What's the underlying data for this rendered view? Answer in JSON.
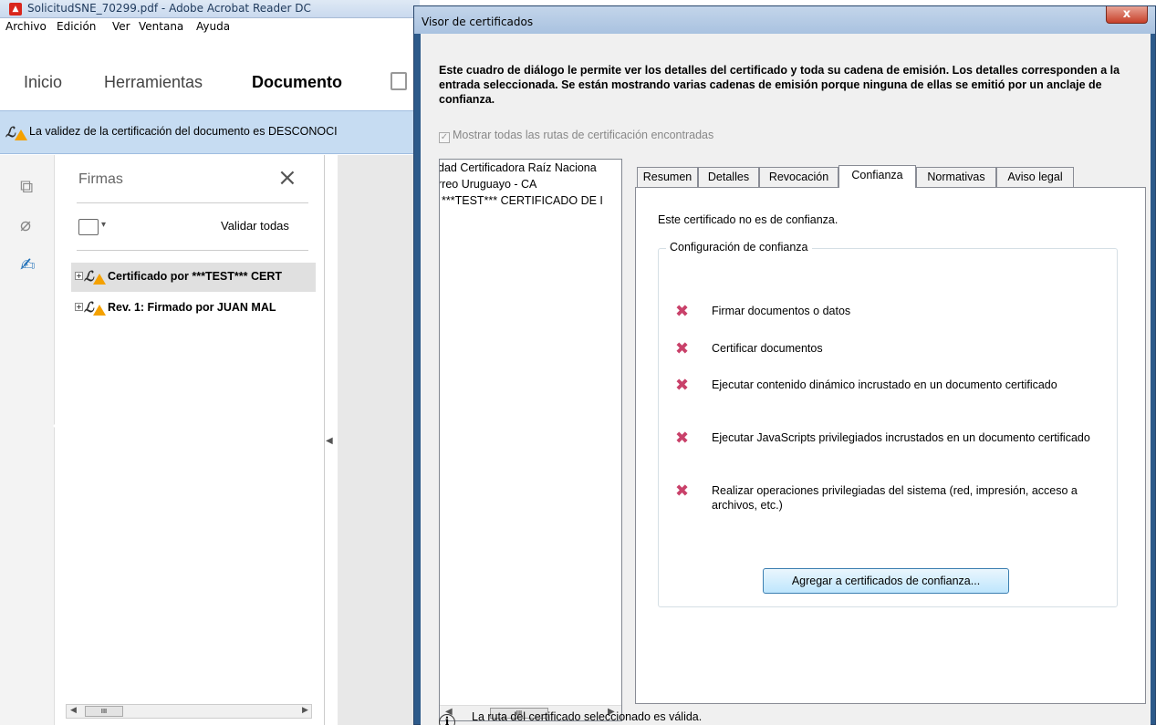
{
  "acrobat": {
    "window_title": "SolicitudSNE_70299.pdf - Adobe Acrobat Reader DC",
    "menu": [
      "Archivo",
      "Edición",
      "Ver",
      "Ventana",
      "Ayuda"
    ],
    "tabs": [
      "Inicio",
      "Herramientas",
      "Documento"
    ],
    "cert_bar_text": "La validez de la certificación del documento es DESCONOCI",
    "signatures_panel": {
      "title": "Firmas",
      "validate_all": "Validar todas",
      "items": [
        "Certificado por ***TEST*** CERT",
        "Rev. 1: Firmado por JUAN  MAL"
      ]
    },
    "scroll_thumb": "III"
  },
  "dialog": {
    "title": "Visor de certificados",
    "close_label": "x",
    "description": "Este cuadro de diálogo le permite ver los detalles del certificado y toda su cadena de emisión. Los detalles corresponden a la entrada seleccionada. Se están mostrando varias cadenas de emisión porque ninguna de ellas se emitió por un anclaje de confianza.",
    "show_all_paths": {
      "label": "Mostrar todas las rutas de certificación encontradas",
      "checked": true
    },
    "chain": [
      "dad Certificadora Raíz Naciona",
      "rreo Uruguayo - CA",
      "***TEST*** CERTIFICADO DE I"
    ],
    "chain_scroll_thumb": "III",
    "tabs": [
      "Resumen",
      "Detalles",
      "Revocación",
      "Confianza",
      "Normativas",
      "Aviso legal"
    ],
    "active_tab": "Confianza",
    "trust": {
      "status_text": "Este certificado no es de confianza.",
      "group_title": "Configuración de confianza",
      "permissions": [
        "Firmar documentos o datos",
        "Certificar documentos",
        "Ejecutar contenido dinámico incrustado en un documento certificado",
        "Ejecutar JavaScripts privilegiados incrustados en un documento certificado",
        "Realizar operaciones privilegiadas del sistema (red, impresión, acceso a archivos, etc.)"
      ],
      "add_button": "Agregar a certificados de confianza..."
    },
    "status_text": "La ruta del certificado seleccionado es válida."
  }
}
